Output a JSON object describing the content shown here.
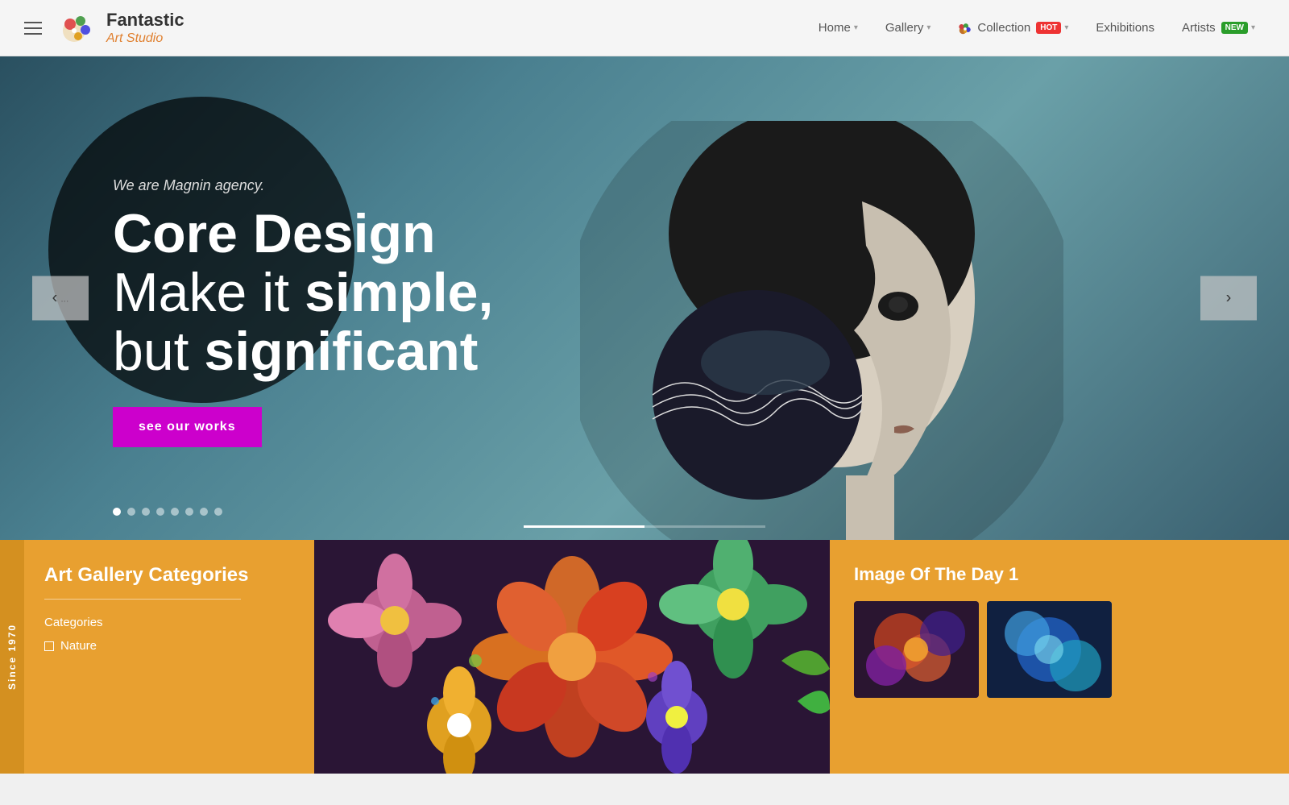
{
  "header": {
    "logo": {
      "brand": "Fantastic",
      "subtitle": "Art Studio"
    },
    "nav": {
      "home": "Home",
      "gallery": "Gallery",
      "collection": "Collection",
      "collection_badge": "HOT",
      "exhibitions": "Exhibitions",
      "artists": "Artists",
      "artists_badge": "NEW"
    }
  },
  "hero": {
    "subtitle": "We are Magnin agency.",
    "title_line1": "Core Design",
    "title_line2": "Make it simple,",
    "title_line3": "but significant",
    "cta_label": "see our works",
    "prev_label": "‹",
    "next_label": "›",
    "dots": [
      1,
      2,
      3,
      4,
      5,
      6,
      7,
      8
    ]
  },
  "bottom": {
    "since_label": "Since 1970",
    "art_gallery": {
      "title": "Art Gallery Categories",
      "divider": true,
      "categories_label": "Categories",
      "items": [
        {
          "label": "Nature"
        }
      ]
    },
    "image_of_day": {
      "title": "Image Of The Day 1"
    }
  }
}
